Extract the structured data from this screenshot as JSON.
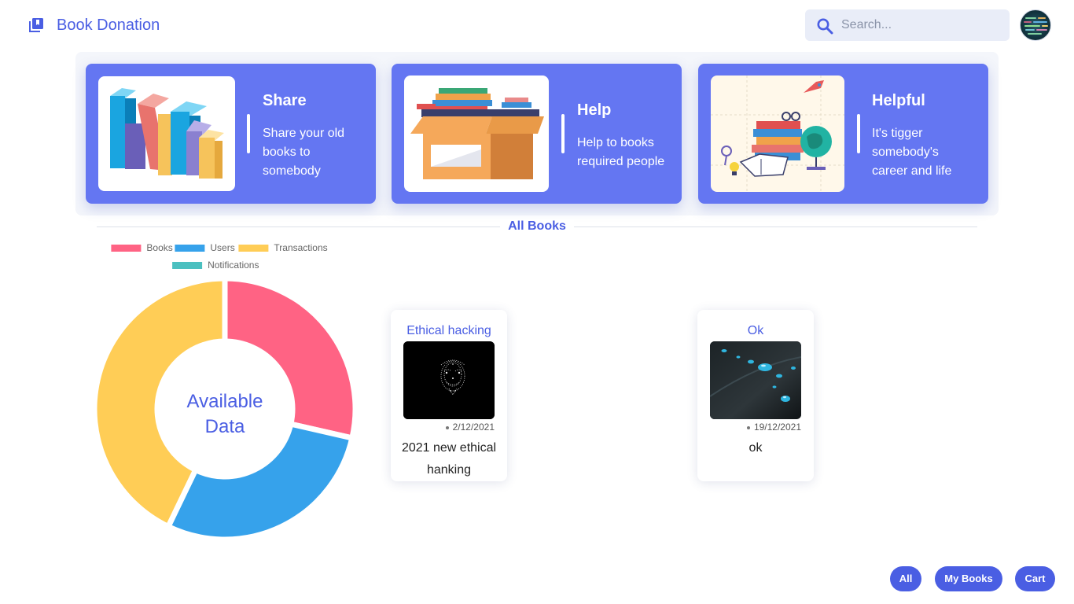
{
  "header": {
    "title": "Book Donation",
    "search_placeholder": "Search...",
    "logo_icon": "library-books-icon",
    "search_icon": "search-icon"
  },
  "features": [
    {
      "title": "Share",
      "description": "Share your old books to somebody",
      "image": "colorful-books-illustration"
    },
    {
      "title": "Help",
      "description": "Help to books required people",
      "image": "box-of-books-illustration"
    },
    {
      "title": "Helpful",
      "description": "It's tigger somebody's career and life",
      "image": "books-globe-illustration"
    }
  ],
  "section": {
    "title": "All Books"
  },
  "chart_data": {
    "type": "doughnut",
    "center_label": "Available Data",
    "legend": [
      "Books",
      "Users",
      "Transactions",
      "Notifications"
    ],
    "values": [
      2,
      2,
      3,
      0
    ],
    "colors": [
      "#ff6384",
      "#36a2eb",
      "#ffcd56",
      "#4bc0c0"
    ],
    "legend_position": "top"
  },
  "books": [
    {
      "title": "Ethical hacking",
      "date": "2/12/2021",
      "description": "2021 new ethical hanking",
      "image": "anonymous-mask-image"
    },
    {
      "title": "Ok",
      "date": "19/12/2021",
      "description": "ok",
      "image": "water-drops-image"
    }
  ],
  "nav": {
    "all": "All",
    "my_books": "My Books",
    "cart": "Cart"
  },
  "colors": {
    "accent": "#4a5ee3",
    "card": "#6476f2"
  }
}
